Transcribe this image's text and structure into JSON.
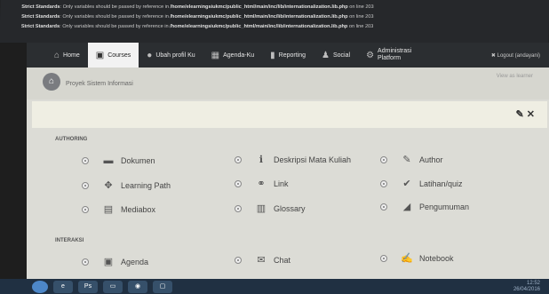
{
  "warnings": [
    {
      "label": "Strict Standards",
      "text": ": Only variables should be passed by reference in ",
      "path": "/home/elearningsiukmc/public_html/main/inc/lib/internationalization.lib.php",
      "suffix": " on line 203"
    },
    {
      "label": "Strict Standards",
      "text": ": Only variables should be passed by reference in ",
      "path": "/home/elearningsiukmc/public_html/main/inc/lib/internationalization.lib.php",
      "suffix": " on line 203"
    },
    {
      "label": "Strict Standards",
      "text": ": Only variables should be passed by reference in ",
      "path": "/home/elearningsiukmc/public_html/main/inc/lib/internationalization.lib.php",
      "suffix": " on line 203"
    }
  ],
  "nav": {
    "home": "Home",
    "courses": "Courses",
    "profile": "Ubah profil Ku",
    "agenda": "Agenda-Ku",
    "reporting": "Reporting",
    "social": "Social",
    "admin_line1": "Administrasi",
    "admin_line2": "Platform",
    "logout": "Logout (andayani)"
  },
  "breadcrumb": "Proyek Sistem Informasi",
  "view_as_learner": "View as learner",
  "panel_tools": {
    "edit": "✎",
    "close": "✕"
  },
  "sections": {
    "authoring": "AUTHORING",
    "interaksi": "INTERAKSI"
  },
  "tools": {
    "dokumen": "Dokumen",
    "deskripsi": "Deskripsi Mata Kuliah",
    "author": "Author",
    "learning_path": "Learning Path",
    "link": "Link",
    "latihan": "Latihan/quiz",
    "mediabox": "Mediabox",
    "glossary": "Glossary",
    "pengumuman": "Pengumuman",
    "agenda": "Agenda",
    "chat": "Chat",
    "notebook": "Notebook"
  },
  "taskbar": {
    "app1": "Ps",
    "clock": "12:52",
    "date": "26/04/2016"
  }
}
